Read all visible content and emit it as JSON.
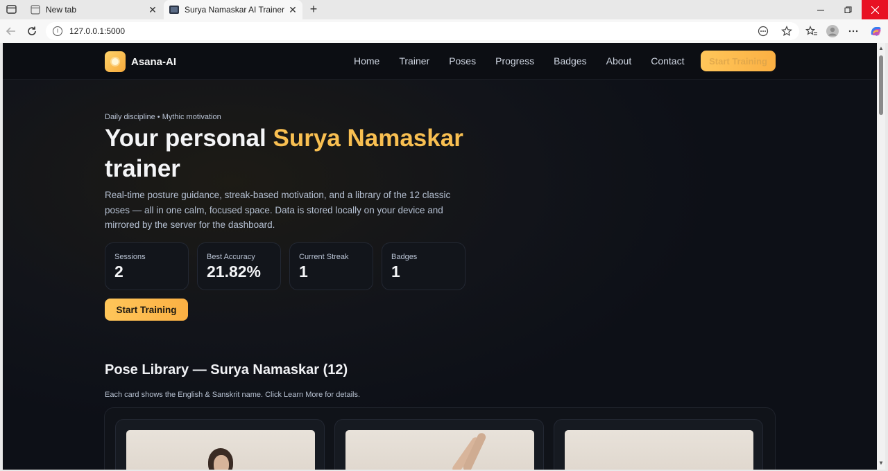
{
  "browser": {
    "tabs": [
      {
        "title": "New tab"
      },
      {
        "title": "Surya Namaskar AI Trainer — Home"
      }
    ],
    "address": "127.0.0.1:5000"
  },
  "nav": {
    "brand": "Asana-AI",
    "links": [
      "Home",
      "Trainer",
      "Poses",
      "Progress",
      "Badges",
      "About",
      "Contact"
    ],
    "cta": "Start Training"
  },
  "hero": {
    "eyebrow": "Daily discipline • Mythic motivation",
    "title_part1": "Your personal ",
    "title_accent": "Surya Namaskar",
    "title_part2": " trainer",
    "description": "Real-time posture guidance, streak-based motivation, and a library of the 12 classic poses — all in one calm, focused space. Data is stored locally on your device and mirrored by the server for the dashboard.",
    "stats": [
      {
        "label": "Sessions",
        "value": "2"
      },
      {
        "label": "Best Accuracy",
        "value": "21.82%"
      },
      {
        "label": "Current Streak",
        "value": "1"
      },
      {
        "label": "Badges",
        "value": "1"
      }
    ],
    "cta": "Start Training"
  },
  "library": {
    "title": "Pose Library — Surya Namaskar (12)",
    "subtitle": "Each card shows the English & Sanskrit name. Click Learn More for details."
  },
  "colors": {
    "accent": "#f8bf51",
    "background": "#0d1017",
    "close_button": "#e81123"
  }
}
